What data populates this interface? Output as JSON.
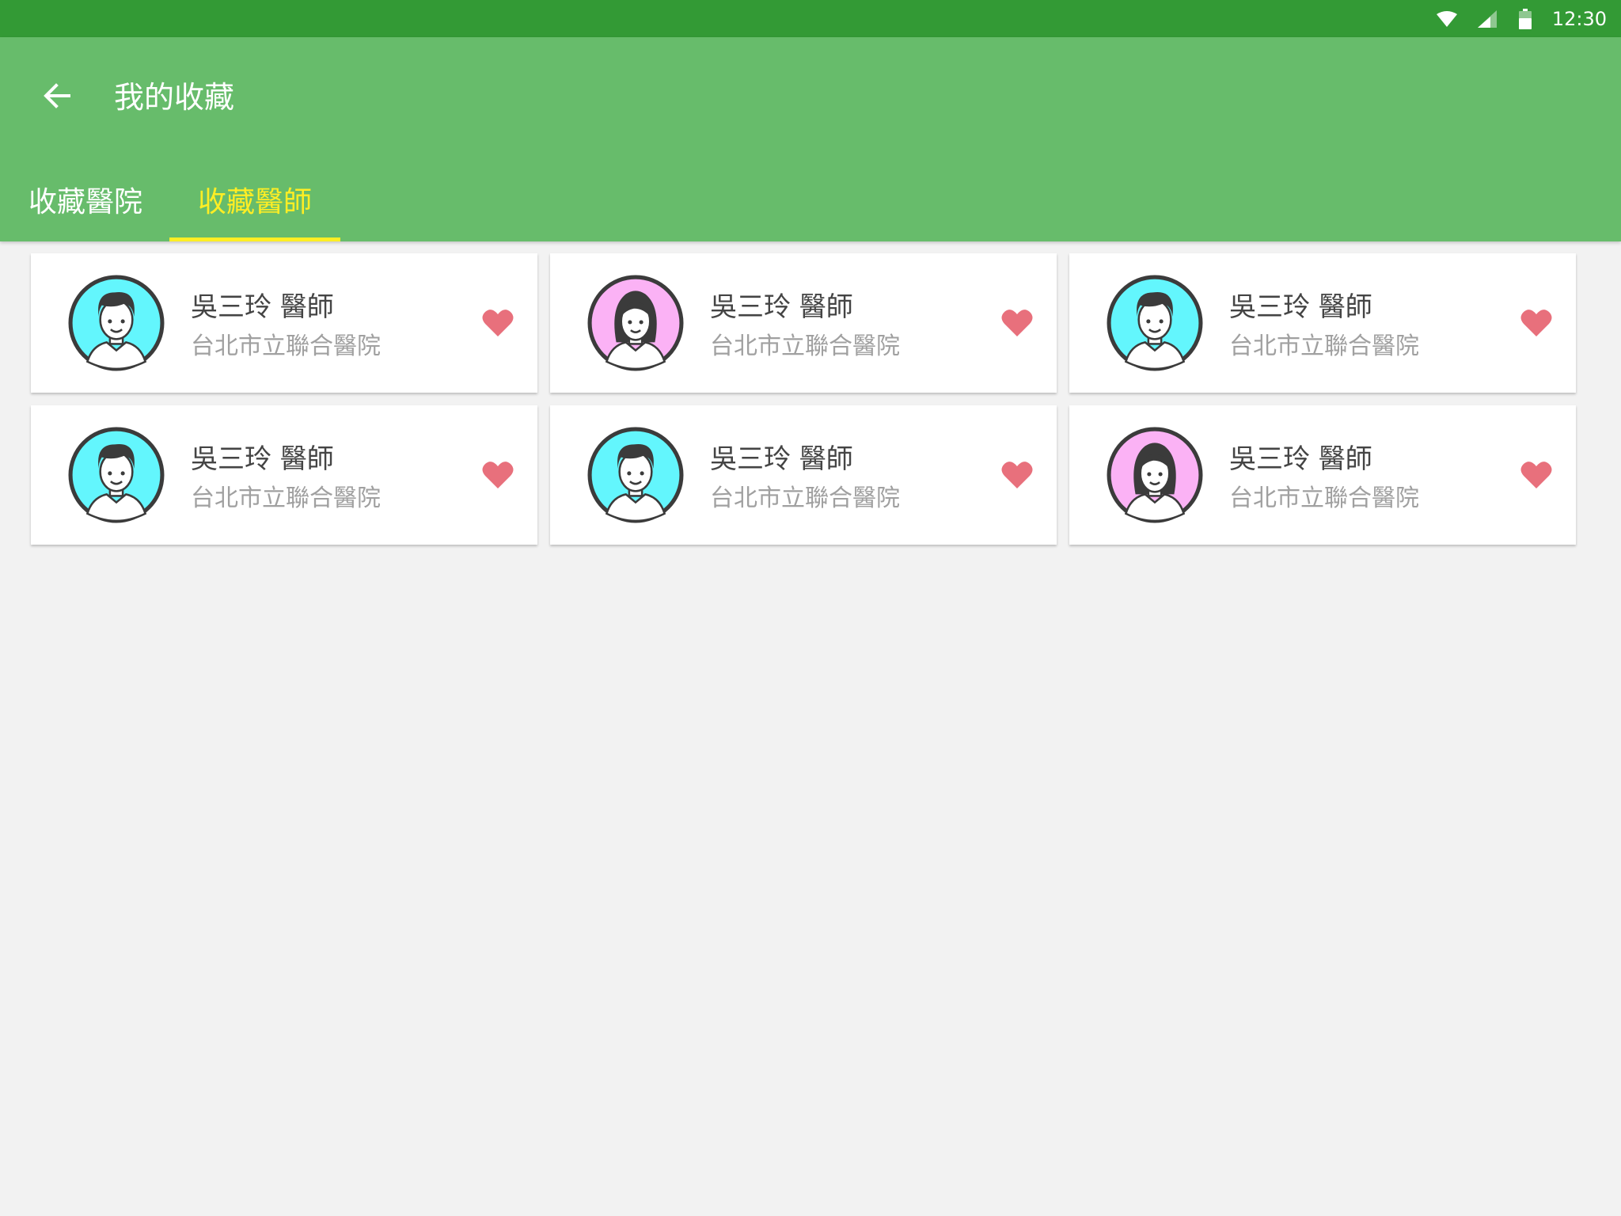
{
  "status_bar": {
    "time": "12:30",
    "icons": [
      "wifi-icon",
      "cellular-signal-icon",
      "battery-icon"
    ]
  },
  "app_bar": {
    "back_icon": "arrow-left-icon",
    "title": "我的收藏",
    "color": "#67bc6b"
  },
  "tabs": [
    {
      "label": "收藏醫院",
      "active": false
    },
    {
      "label": "收藏醫師",
      "active": true
    }
  ],
  "colors": {
    "status_bar": "#339a35",
    "active_tab": "#ffee24",
    "heart": "#e8707c",
    "avatar_male_bg": "#63f6fd",
    "avatar_female_bg": "#fbb2f5",
    "background": "#f2f2f2"
  },
  "doctors": [
    {
      "name": "吳三玲 醫師",
      "hospital": "台北市立聯合醫院",
      "avatar": "male",
      "favorited": true,
      "favorite_icon": "heart-icon"
    },
    {
      "name": "吳三玲 醫師",
      "hospital": "台北市立聯合醫院",
      "avatar": "female",
      "favorited": true,
      "favorite_icon": "heart-icon"
    },
    {
      "name": "吳三玲 醫師",
      "hospital": "台北市立聯合醫院",
      "avatar": "male",
      "favorited": true,
      "favorite_icon": "heart-icon"
    },
    {
      "name": "吳三玲 醫師",
      "hospital": "台北市立聯合醫院",
      "avatar": "male",
      "favorited": true,
      "favorite_icon": "heart-icon"
    },
    {
      "name": "吳三玲 醫師",
      "hospital": "台北市立聯合醫院",
      "avatar": "male",
      "favorited": true,
      "favorite_icon": "heart-icon"
    },
    {
      "name": "吳三玲 醫師",
      "hospital": "台北市立聯合醫院",
      "avatar": "female",
      "favorited": true,
      "favorite_icon": "heart-icon"
    }
  ]
}
